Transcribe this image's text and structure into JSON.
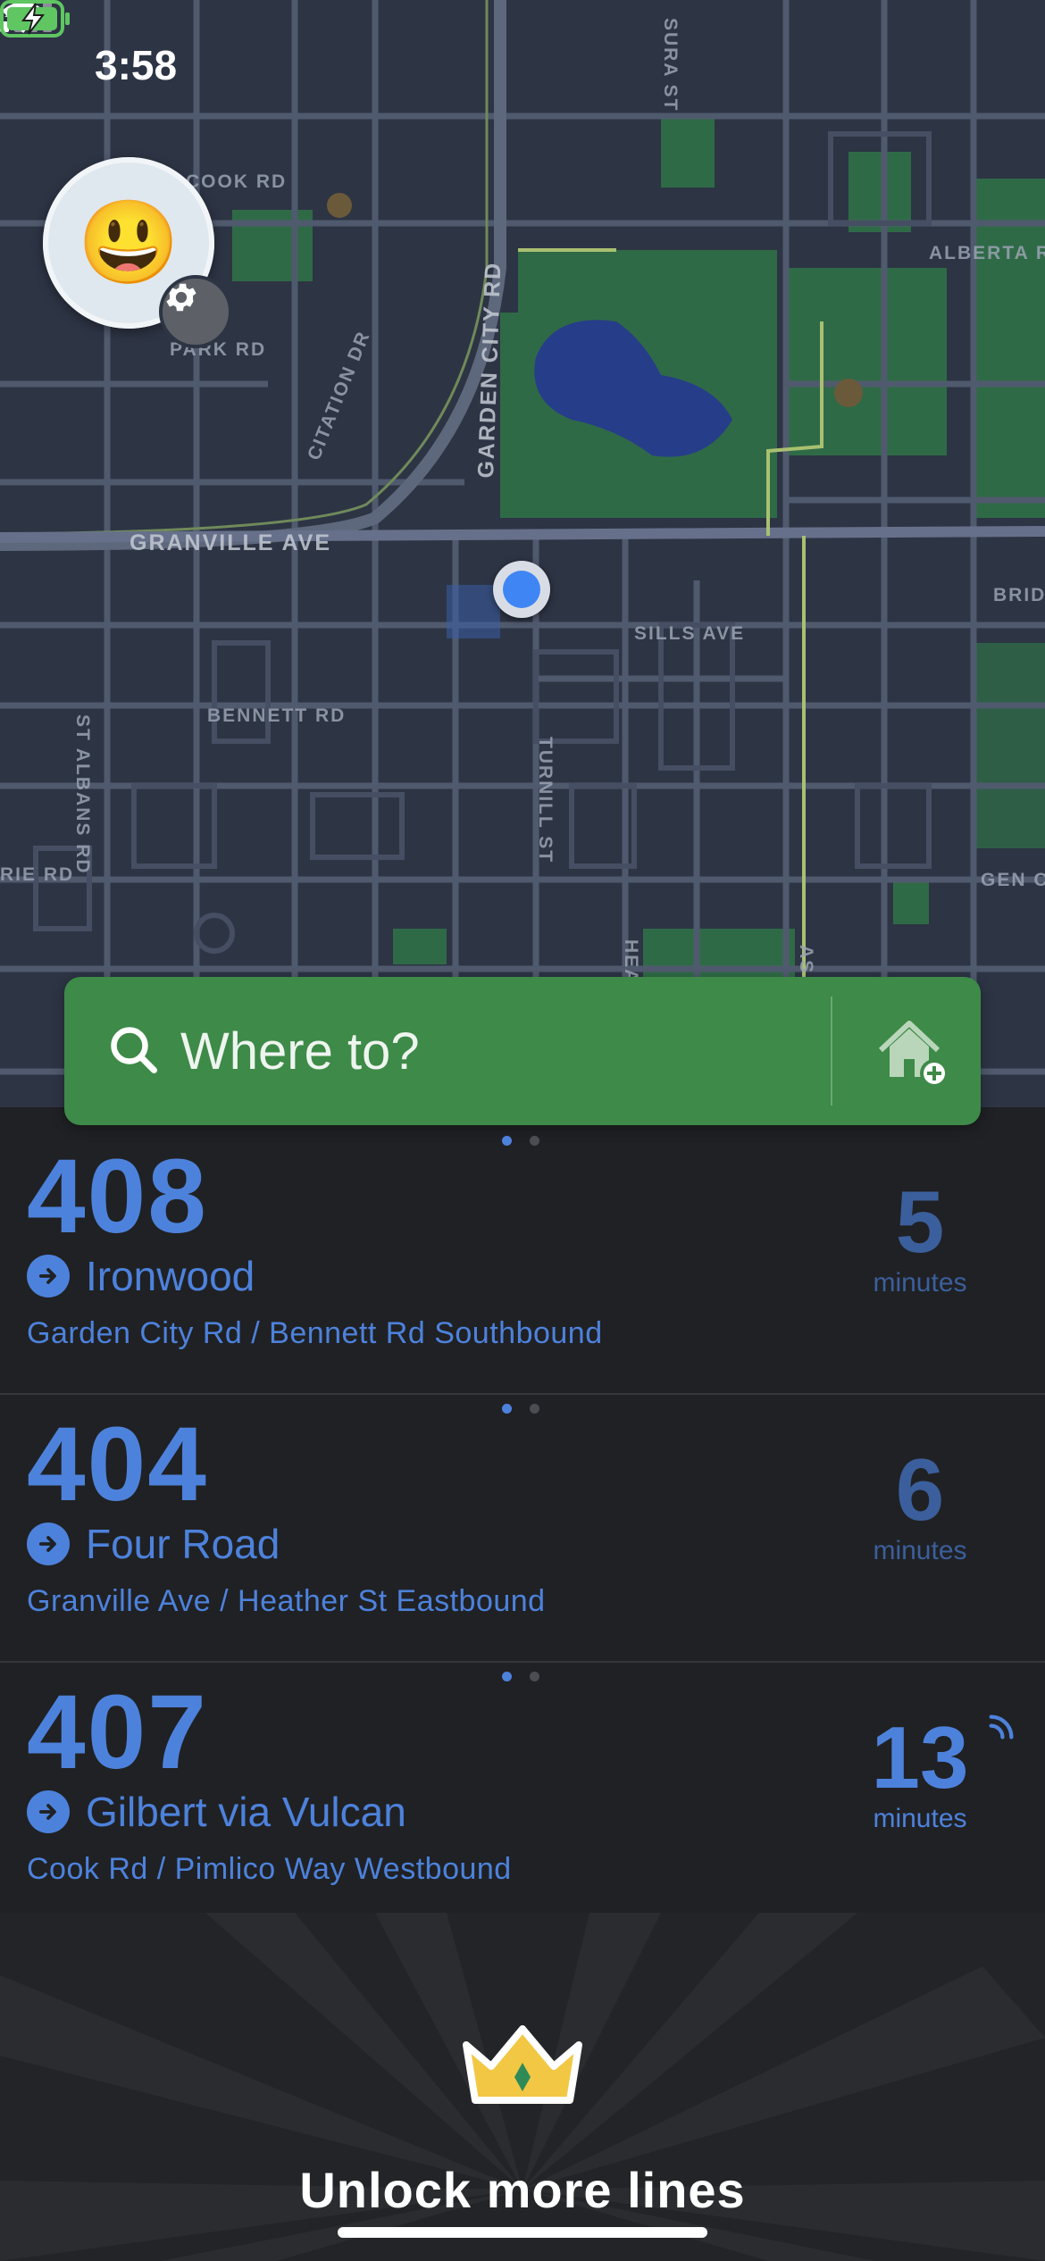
{
  "status_bar": {
    "time": "3:58"
  },
  "map": {
    "streets": [
      "COOK RD",
      "ALBERTA R",
      "PARK RD",
      "CITATION DR",
      "GARDEN CITY RD",
      "GRANVILLE AVE",
      "ST ALBANS RD",
      "SILLS AVE",
      "BRID",
      "BENNETT RD",
      "TURNILL ST",
      "RIE RD",
      "GEN C",
      "SURA ST",
      "HEA",
      "AS"
    ]
  },
  "search": {
    "placeholder": "Where to?"
  },
  "departures": [
    {
      "route": "408",
      "destination": "Ironwood",
      "stop": "Garden City Rd / Bennett Rd Southbound",
      "minutes": "5",
      "minutes_label": "minutes",
      "realtime": false
    },
    {
      "route": "404",
      "destination": "Four Road",
      "stop": "Granville Ave / Heather St Eastbound",
      "minutes": "6",
      "minutes_label": "minutes",
      "realtime": false
    },
    {
      "route": "407",
      "destination": "Gilbert via Vulcan",
      "stop": "Cook Rd / Pimlico Way Westbound",
      "minutes": "13",
      "minutes_label": "minutes",
      "realtime": true
    }
  ],
  "upsell": {
    "label": "Unlock more lines"
  },
  "colors": {
    "accent": "#4d82dc",
    "search_bar": "#3e8a48",
    "background": "#202124",
    "map": "#2d3444"
  },
  "icons": [
    "location-arrow-icon",
    "signal-icon",
    "wifi-icon",
    "battery-charging-icon",
    "gear-icon",
    "search-icon",
    "home-add-icon",
    "arrow-right-icon",
    "realtime-icon",
    "crown-icon"
  ]
}
